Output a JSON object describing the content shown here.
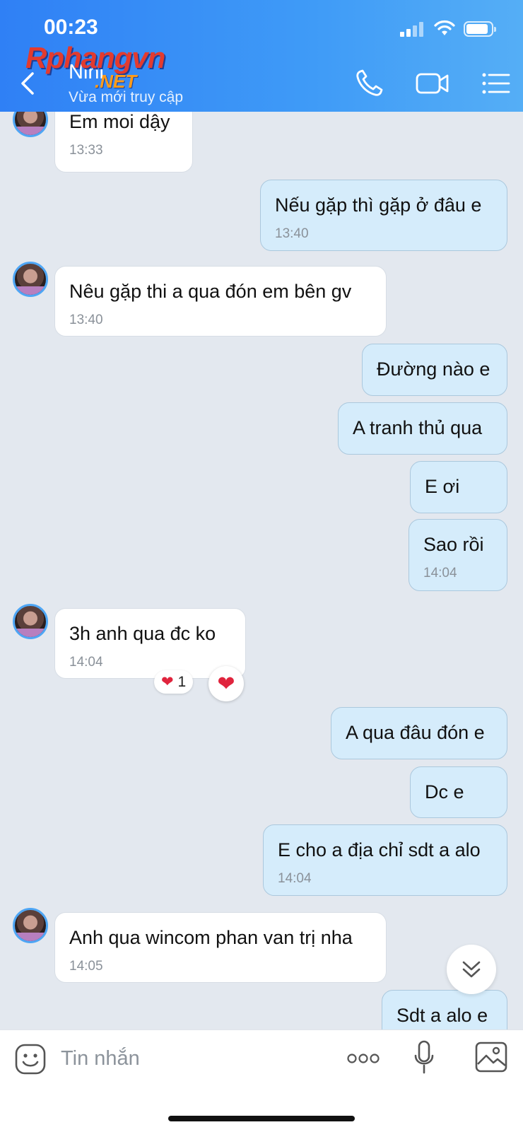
{
  "status_bar": {
    "time": "00:23",
    "signal_icon": "signal-icon",
    "wifi_icon": "wifi-icon",
    "battery_icon": "battery-icon"
  },
  "watermark": {
    "main": "Rphangvn",
    "suffix": ".NET"
  },
  "header": {
    "title": "Nini",
    "subtitle": "Vừa mới truy cập",
    "back_icon": "chevron-left-icon",
    "actions": [
      "phone-icon",
      "video-camera-icon",
      "menu-list-icon"
    ]
  },
  "messages": [
    {
      "dir": "in",
      "text": " Em moi dậy",
      "time": "13:33"
    },
    {
      "dir": "out",
      "text": "Nếu gặp thì gặp ở đâu e",
      "time": "13:40"
    },
    {
      "dir": "in",
      "text": "Nêu gặp thi a qua đón em bên gv",
      "time": "13:40"
    },
    {
      "dir": "out",
      "text": "Đường nào e",
      "time": ""
    },
    {
      "dir": "out",
      "text": "A tranh thủ qua",
      "time": ""
    },
    {
      "dir": "out",
      "text": "E ơi",
      "time": ""
    },
    {
      "dir": "out",
      "text": "Sao rồi",
      "time": "14:04"
    },
    {
      "dir": "in",
      "text": " 3h anh qua đc ko",
      "time": "14:04",
      "reaction_count": "1"
    },
    {
      "dir": "out",
      "text": "A qua đâu đón e",
      "time": ""
    },
    {
      "dir": "out",
      "text": "Dc e",
      "time": ""
    },
    {
      "dir": "out",
      "text": "E cho a địa chỉ sdt a alo",
      "time": "14:04"
    },
    {
      "dir": "in",
      "text": "Anh qua wincom phan van trị nha",
      "time": "14:05"
    },
    {
      "dir": "out",
      "text": "Sdt a alo e",
      "time": ""
    }
  ],
  "composer": {
    "placeholder": "Tin nhắn",
    "icons": [
      "sticker-icon",
      "more-icon",
      "microphone-icon",
      "image-icon"
    ]
  },
  "colors": {
    "header_start": "#2f80f5",
    "header_end": "#55aef6",
    "outgoing_bubble": "#d5ecfb",
    "incoming_bubble": "#ffffff",
    "chat_bg": "#e3e8ef"
  }
}
